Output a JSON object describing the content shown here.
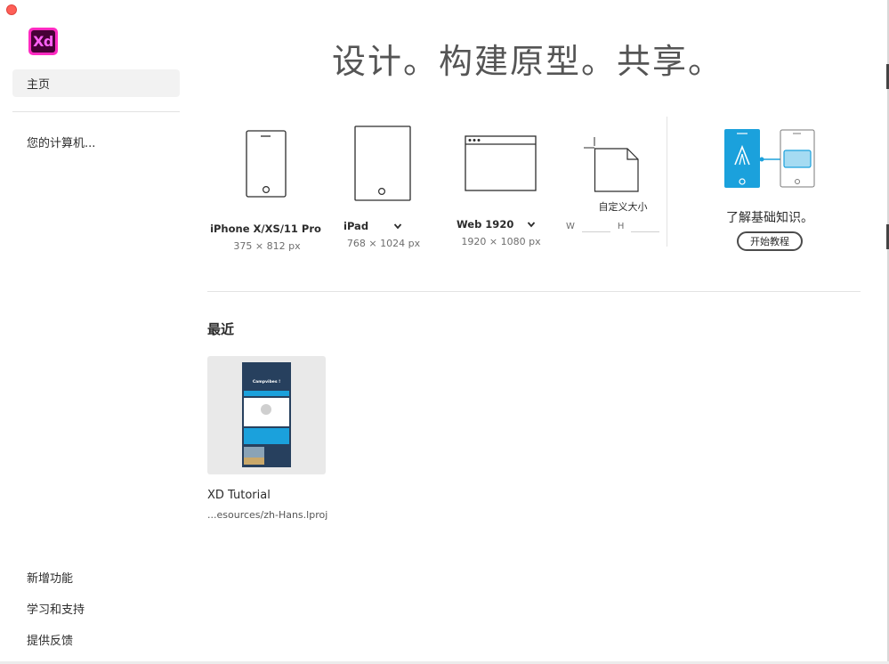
{
  "app": {
    "logo_text": "Xd",
    "brand_color": "#ff2bc2"
  },
  "sidebar": {
    "home": "主页",
    "your_computer": "您的计算机...",
    "whats_new": "新增功能",
    "learn_support": "学习和支持",
    "feedback": "提供反馈"
  },
  "hero": {
    "title": "设计。构建原型。共享。"
  },
  "presets": [
    {
      "name": "iPhone X/XS/11 Pro",
      "size": "375 × 812 px"
    },
    {
      "name": "iPad",
      "size": "768 × 1024 px"
    },
    {
      "name": "Web 1920",
      "size": "1920 × 1080 px"
    }
  ],
  "custom": {
    "label": "自定义大小",
    "w_label": "W",
    "h_label": "H",
    "w_value": "",
    "h_value": ""
  },
  "learn": {
    "title": "了解基础知识。",
    "button": "开始教程",
    "accent": "#1ba1dc"
  },
  "recent": {
    "heading": "最近",
    "files": [
      {
        "name": "XD Tutorial",
        "path": "...esources/zh-Hans.lproj",
        "thumb_title": "Campvibes !"
      }
    ]
  }
}
